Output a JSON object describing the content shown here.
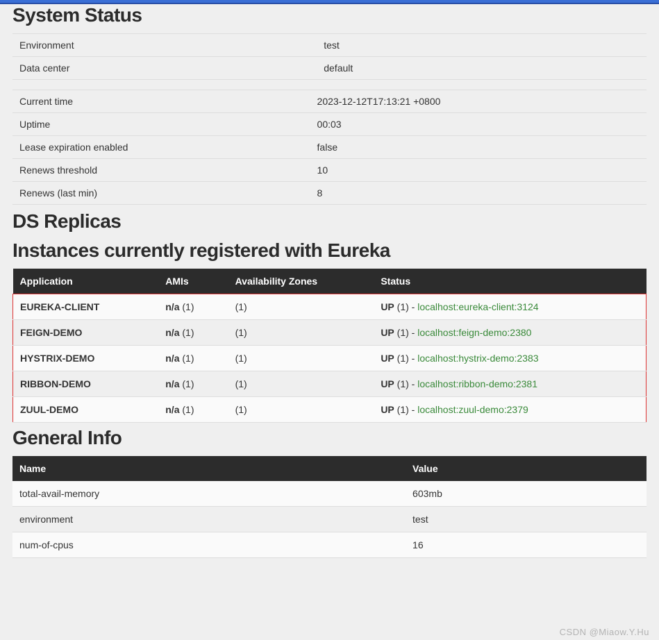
{
  "headings": {
    "system_status": "System Status",
    "ds_replicas": "DS Replicas",
    "instances": "Instances currently registered with Eureka",
    "general_info": "General Info"
  },
  "system_status_env": [
    {
      "key": "Environment",
      "value": "test"
    },
    {
      "key": "Data center",
      "value": "default"
    }
  ],
  "system_status_time": [
    {
      "key": "Current time",
      "value": "2023-12-12T17:13:21 +0800"
    },
    {
      "key": "Uptime",
      "value": "00:03"
    },
    {
      "key": "Lease expiration enabled",
      "value": "false"
    },
    {
      "key": "Renews threshold",
      "value": "10"
    },
    {
      "key": "Renews (last min)",
      "value": "8"
    }
  ],
  "instances_table": {
    "headers": {
      "application": "Application",
      "amis": "AMIs",
      "zones": "Availability Zones",
      "status": "Status"
    },
    "rows": [
      {
        "app": "EUREKA-CLIENT",
        "amis_label": "n/a",
        "amis_count": "(1)",
        "zones": "(1)",
        "status_label": "UP",
        "status_count": "(1)",
        "dash": " - ",
        "link": "localhost:eureka-client:3124"
      },
      {
        "app": "FEIGN-DEMO",
        "amis_label": "n/a",
        "amis_count": "(1)",
        "zones": "(1)",
        "status_label": "UP",
        "status_count": "(1)",
        "dash": " - ",
        "link": "localhost:feign-demo:2380"
      },
      {
        "app": "HYSTRIX-DEMO",
        "amis_label": "n/a",
        "amis_count": "(1)",
        "zones": "(1)",
        "status_label": "UP",
        "status_count": "(1)",
        "dash": " - ",
        "link": "localhost:hystrix-demo:2383"
      },
      {
        "app": "RIBBON-DEMO",
        "amis_label": "n/a",
        "amis_count": "(1)",
        "zones": "(1)",
        "status_label": "UP",
        "status_count": "(1)",
        "dash": " - ",
        "link": "localhost:ribbon-demo:2381"
      },
      {
        "app": "ZUUL-DEMO",
        "amis_label": "n/a",
        "amis_count": "(1)",
        "zones": "(1)",
        "status_label": "UP",
        "status_count": "(1)",
        "dash": " - ",
        "link": "localhost:zuul-demo:2379"
      }
    ]
  },
  "general_info": {
    "headers": {
      "name": "Name",
      "value": "Value"
    },
    "rows": [
      {
        "name": "total-avail-memory",
        "value": "603mb"
      },
      {
        "name": "environment",
        "value": "test"
      },
      {
        "name": "num-of-cpus",
        "value": "16"
      }
    ]
  },
  "watermark": "CSDN @Miaow.Y.Hu"
}
